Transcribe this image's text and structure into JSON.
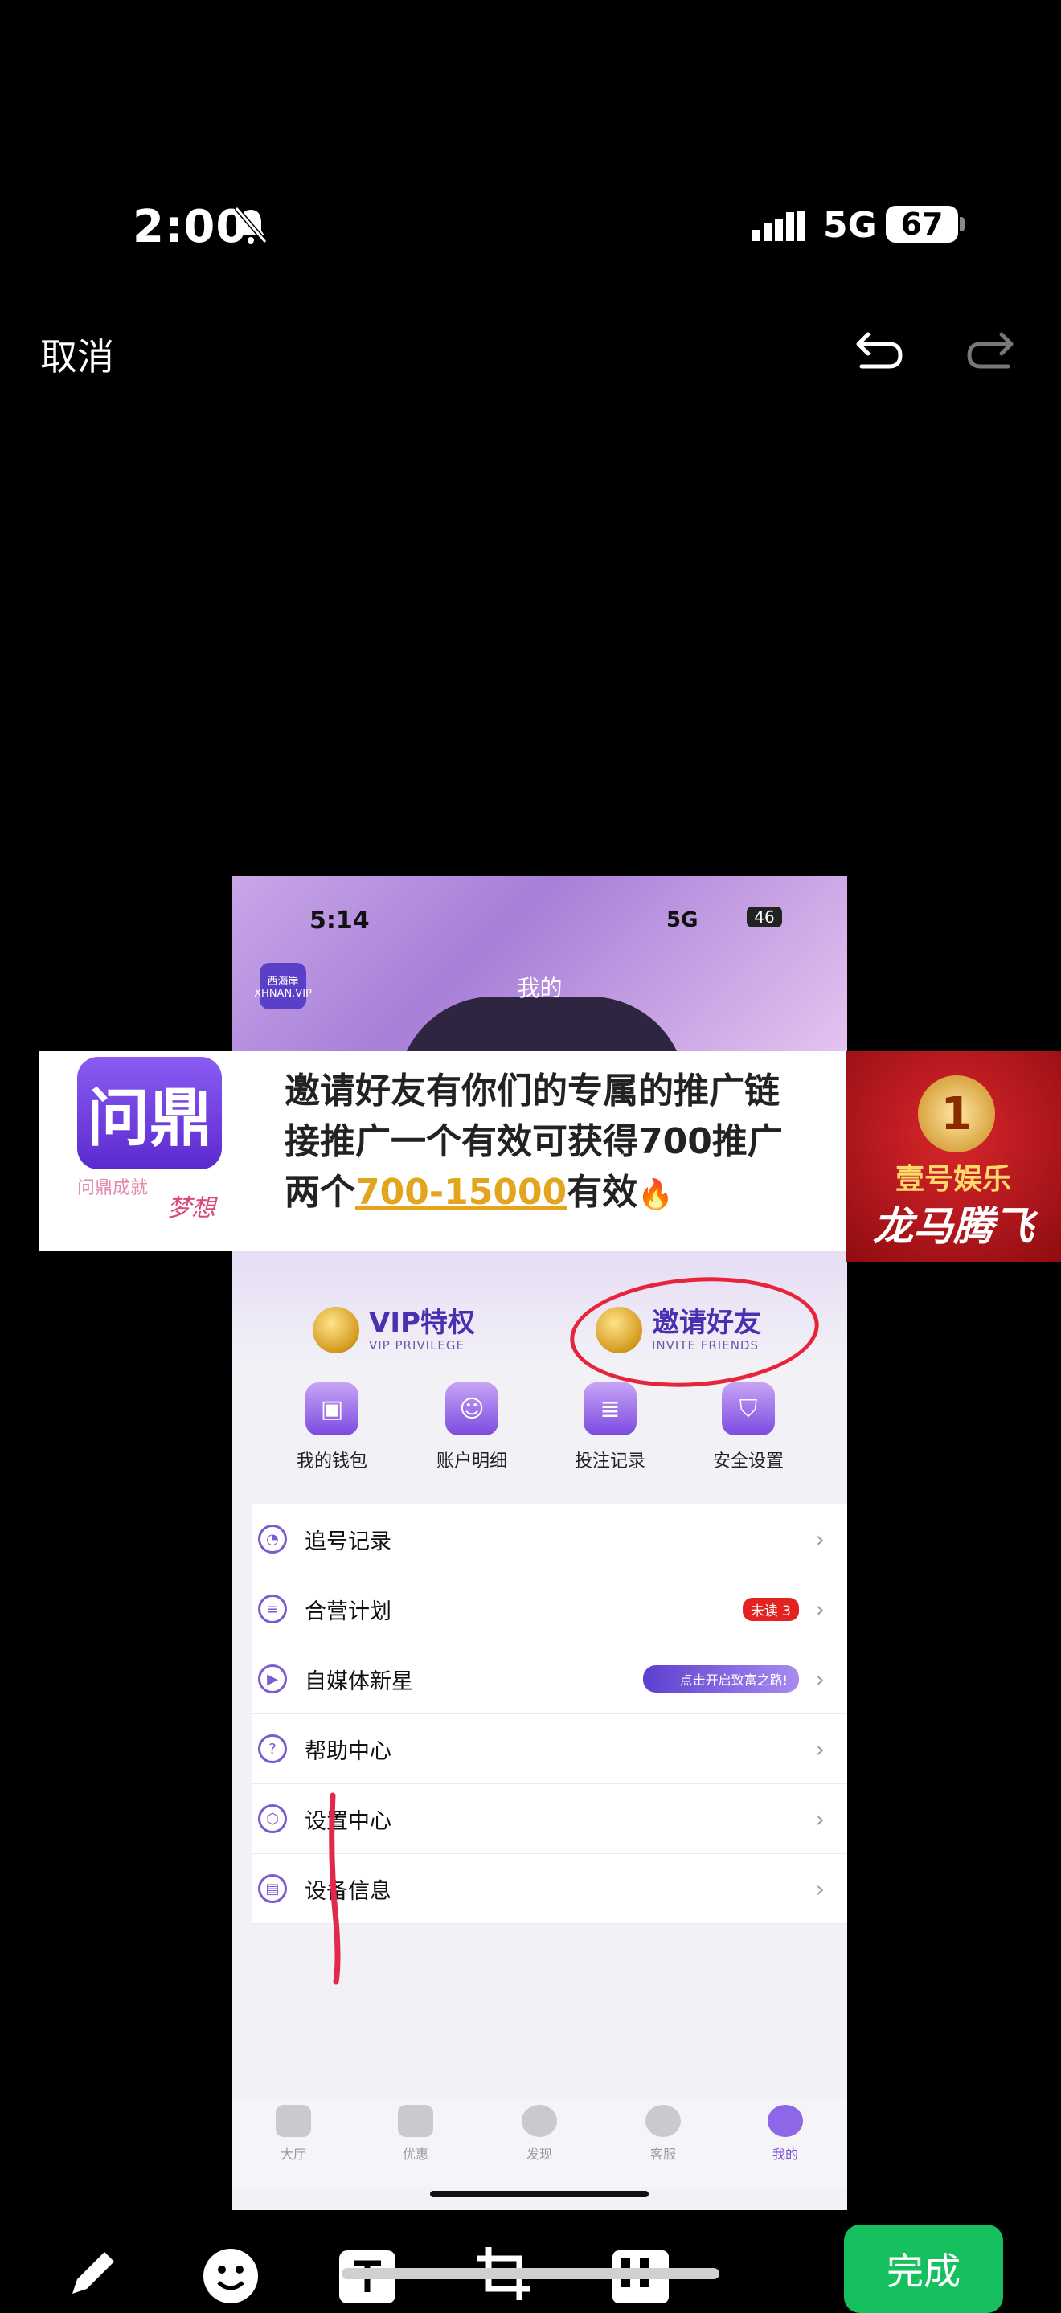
{
  "status_bar": {
    "time": "2:00",
    "network": "5G",
    "battery": "67"
  },
  "editor": {
    "cancel": "取消",
    "done": "完成"
  },
  "phone": {
    "time": "5:14",
    "network": "5G",
    "battery": "46",
    "app_logo": "西海岸 XHNAN.VIP",
    "page_title": "我的",
    "vip": {
      "title": "VIP特权",
      "subtitle": "VIP PRIVILEGE"
    },
    "invite": {
      "title": "邀请好友",
      "subtitle": "INVITE FRIENDS"
    },
    "quick_actions": [
      {
        "label": "我的钱包"
      },
      {
        "label": "账户明细"
      },
      {
        "label": "投注记录"
      },
      {
        "label": "安全设置"
      }
    ],
    "menu": [
      {
        "label": "追号记录",
        "icon": "clock-icon"
      },
      {
        "label": "合营计划",
        "icon": "plan-icon",
        "badge": "未读 3"
      },
      {
        "label": "自媒体新星",
        "icon": "media-icon",
        "promo": "点击开启致富之路!"
      },
      {
        "label": "帮助中心",
        "icon": "help-icon"
      },
      {
        "label": "设置中心",
        "icon": "settings-icon"
      },
      {
        "label": "设备信息",
        "icon": "device-icon"
      }
    ],
    "tabs": [
      {
        "label": "大厅"
      },
      {
        "label": "优惠"
      },
      {
        "label": "发现"
      },
      {
        "label": "客服"
      },
      {
        "label": "我的"
      }
    ]
  },
  "banner": {
    "logo_text": "问鼎",
    "logo_sub": "问鼎成就",
    "logo_dream": "梦想",
    "line1": "邀请好友有你们的专属的推广链",
    "line2": "接推广一个有效可获得700推广",
    "line3_pre": "两个",
    "line3_highlight": "700-15000",
    "line3_post": "有效",
    "brand_top": "壹号娱乐",
    "brand_slogan": "龙马腾飞"
  }
}
